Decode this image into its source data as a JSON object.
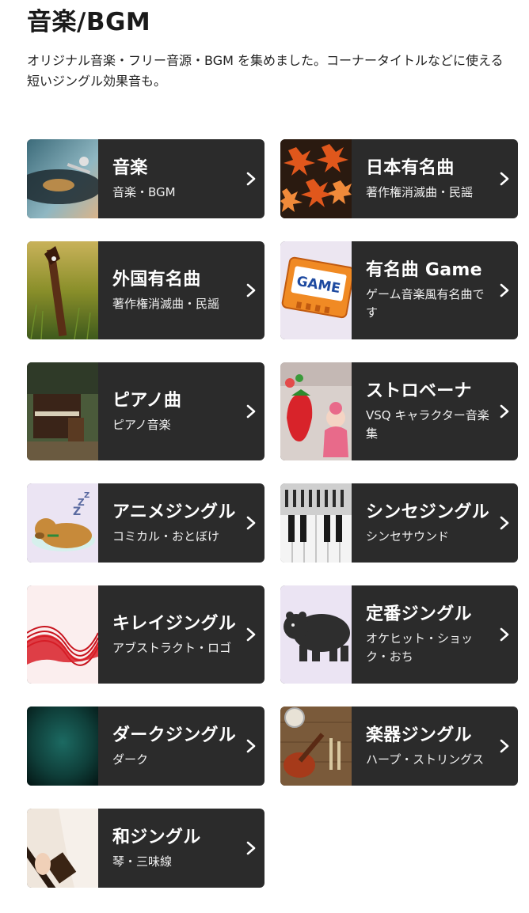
{
  "page": {
    "title": "音楽/BGM",
    "description": "オリジナル音楽・フリー音源・BGM を集めました。コーナータイトルなどに使える短いジングル効果音も。"
  },
  "cards": [
    {
      "title": "音楽",
      "subtitle": "音楽・BGM",
      "thumb": "turntable"
    },
    {
      "title": "日本有名曲",
      "subtitle": "著作権消滅曲・民謡",
      "thumb": "autumn-leaves"
    },
    {
      "title": "外国有名曲",
      "subtitle": "著作権消滅曲・民謡",
      "thumb": "guitar-grass"
    },
    {
      "title": "有名曲 Game",
      "subtitle": "ゲーム音楽風有名曲です",
      "thumb": "game-cartridge"
    },
    {
      "title": "ピアノ曲",
      "subtitle": "ピアノ音楽",
      "thumb": "old-piano"
    },
    {
      "title": "ストロベーナ",
      "subtitle": "VSQ キャラクター音楽集",
      "thumb": "strawberry-character"
    },
    {
      "title": "アニメジングル",
      "subtitle": "コミカル・おとぼけ",
      "thumb": "sleeping-dog"
    },
    {
      "title": "シンセジングル",
      "subtitle": "シンセサウンド",
      "thumb": "synthesizer"
    },
    {
      "title": "キレイジングル",
      "subtitle": "アブストラクト・ロゴ",
      "thumb": "red-waves"
    },
    {
      "title": "定番ジングル",
      "subtitle": "オケヒット・ショック・おち",
      "thumb": "black-bear"
    },
    {
      "title": "ダークジングル",
      "subtitle": "ダーク",
      "thumb": "dark-texture"
    },
    {
      "title": "楽器ジングル",
      "subtitle": "ハープ・ストリングス",
      "thumb": "instruments"
    },
    {
      "title": "和ジングル",
      "subtitle": "琴・三味線",
      "thumb": "shamisen"
    }
  ],
  "colors": {
    "card_bg": "#2b2b2b",
    "text_on_card": "#ffffff",
    "page_bg": "#ffffff"
  }
}
